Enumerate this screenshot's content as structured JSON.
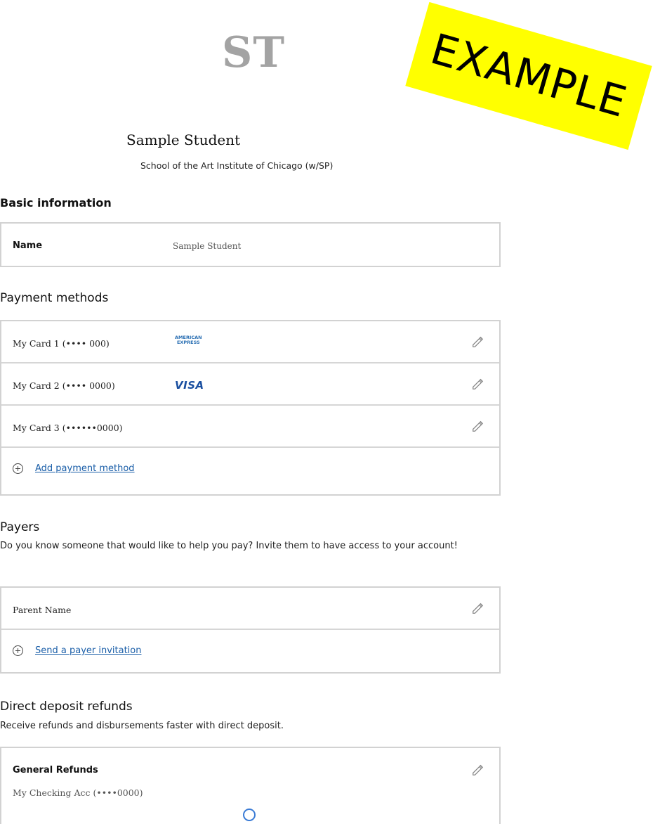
{
  "profile": {
    "initials": "ST",
    "name": "Sample Student",
    "school": "School of the Art Institute of Chicago (w/SP)"
  },
  "watermark": {
    "text": "EXAMPLE",
    "color": "#ffff00"
  },
  "basic_info": {
    "title": "Basic information",
    "name_label": "Name",
    "name_value": "Sample Student"
  },
  "payment_methods": {
    "title": "Payment methods",
    "items": [
      {
        "label": "My Card 1 (•••• 000)",
        "brand": "AMERICAN EXPRESS",
        "brand_icon": "amex-logo"
      },
      {
        "label": "My Card 2 (•••• 0000)",
        "brand": "VISA",
        "brand_icon": "visa-logo"
      },
      {
        "label": "My Card 3 (••••••0000)",
        "brand": "",
        "brand_icon": ""
      }
    ],
    "add_label": "Add payment method"
  },
  "payers": {
    "title": "Payers",
    "description": "Do you know someone that would like to help you pay? Invite them to have access to your account!",
    "items": [
      {
        "label": "Parent Name"
      }
    ],
    "add_label": "Send a payer invitation"
  },
  "direct_deposit": {
    "title": "Direct deposit refunds",
    "description": "Receive refunds and disbursements faster with direct deposit.",
    "general_title": "General Refunds",
    "account": "My Checking Acc (••••0000)"
  },
  "colors": {
    "link": "#1a5ea8",
    "border": "#d2d2d2",
    "avatar_text": "#a3a3a3"
  }
}
